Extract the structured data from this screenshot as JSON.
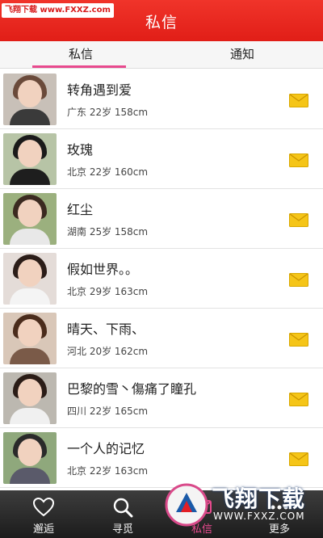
{
  "watermark": "飞翔下载 www.FXXZ.com",
  "header": {
    "title": "私信"
  },
  "tabs": [
    {
      "label": "私信",
      "active": true
    },
    {
      "label": "通知",
      "active": false
    }
  ],
  "messages": [
    {
      "name": "转角遇到爱",
      "info": "广东 22岁 158cm",
      "icon": "mail-envelope-icon"
    },
    {
      "name": "玫瑰",
      "info": "北京 22岁 160cm",
      "icon": "mail-envelope-icon"
    },
    {
      "name": "红尘",
      "info": "湖南 25岁 158cm",
      "icon": "mail-envelope-icon"
    },
    {
      "name": "假如世界。。",
      "info": "北京 29岁 163cm",
      "icon": "mail-envelope-icon"
    },
    {
      "name": "晴天、下雨、",
      "info": "河北 20岁 162cm",
      "icon": "mail-envelope-icon"
    },
    {
      "name": "巴黎的雪丶傷痛了瞳孔",
      "info": "四川 22岁 165cm",
      "icon": "mail-envelope-icon"
    },
    {
      "name": "一个人的记忆",
      "info": "北京 22岁 163cm",
      "icon": "mail-envelope-icon"
    }
  ],
  "bottom_nav": [
    {
      "label": "邂逅",
      "icon": "heart-icon"
    },
    {
      "label": "寻觅",
      "icon": "search-icon"
    },
    {
      "label": "私信",
      "icon": "message-icon",
      "active": true
    },
    {
      "label": "更多",
      "icon": "more-icon"
    }
  ],
  "promo": {
    "title": "飞翔下载",
    "url": "WWW.FXXZ.COM"
  },
  "colors": {
    "header": "#e11e17",
    "accent": "#e84a8e",
    "mail": "#f5c518"
  }
}
